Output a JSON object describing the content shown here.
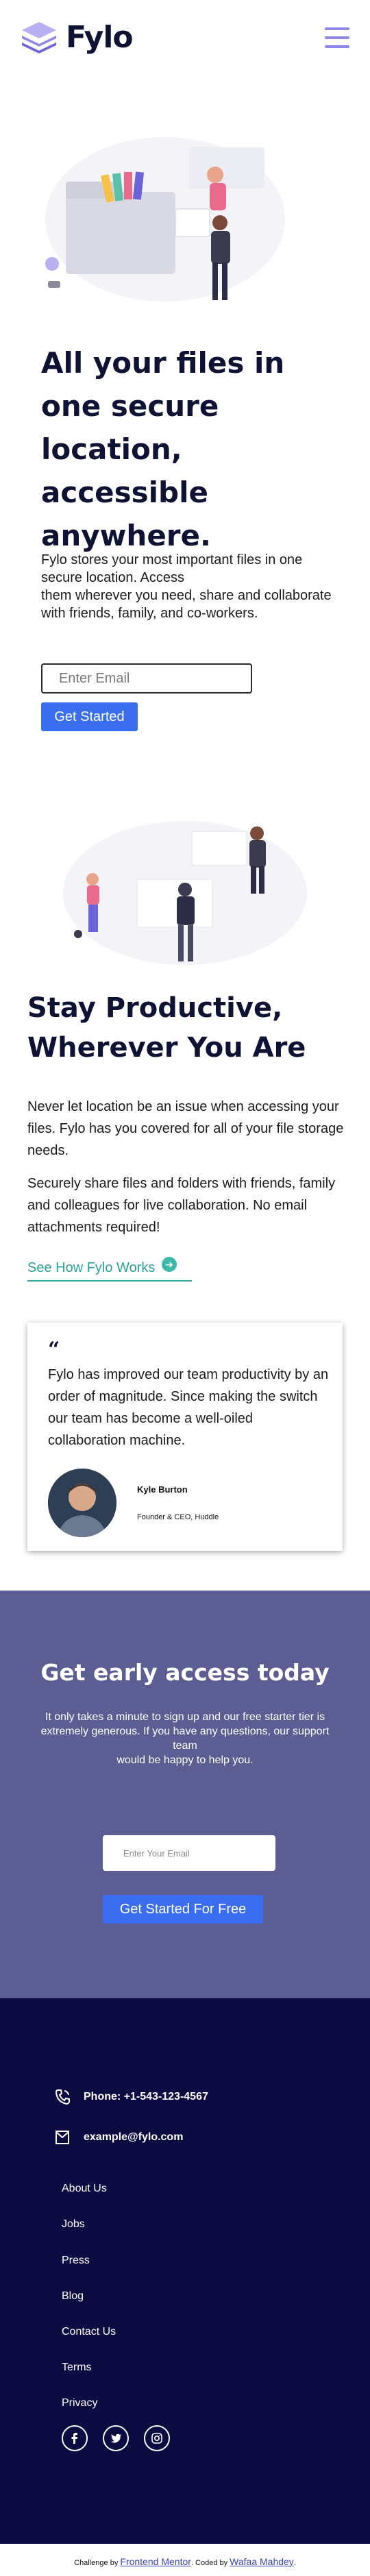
{
  "header": {
    "brand": "Fylo",
    "menu_icon": "hamburger-menu-icon"
  },
  "hero": {
    "title": "All your files in one secure location, accessible anywhere.",
    "text_line1": "Fylo stores your most important files in one secure location. Access",
    "text_line2": "them wherever you need,  share and collaborate with friends, family, and co-workers.",
    "email_placeholder": "Enter Email",
    "cta_label": "Get Started"
  },
  "productive": {
    "title": "Stay Productive, Wherever You Are",
    "paragraph1": "Never let location be an issue when accessing your files. Fylo has you covered for all of your file storage needs.",
    "paragraph2": "Securely share files and folders with friends, family and colleagues for live collaboration. No email attachments required!",
    "link_label": "See How Fylo Works",
    "link_icon": "arrow-right-icon"
  },
  "testimonial": {
    "quote_mark": "“",
    "text": "Fylo has improved our team productivity by an order of magnitude. Since making the switch our team has become a well-oiled collaboration machine.",
    "name": "Kyle Burton",
    "role": "Founder & CEO, Huddle"
  },
  "early_access": {
    "title": "Get early access today",
    "text_line1": "It only takes a minute to sign up and our free starter tier is extremely generous. If you have any questions, our support team",
    "text_line2": "would be happy to help you.",
    "email_placeholder": "Enter Your Email",
    "cta_label": "Get Started For Free"
  },
  "footer": {
    "phone": "Phone: +1-543-123-4567",
    "email": "example@fylo.com",
    "links": [
      "About Us",
      "Jobs",
      "Press",
      "Blog",
      "Contact Us",
      "Terms",
      "Privacy"
    ],
    "socials": [
      "facebook-icon",
      "twitter-icon",
      "instagram-icon"
    ]
  },
  "attribution": {
    "prefix": "Challenge by",
    "challenge_link": "Frontend Mentor",
    "middle": ". Coded by",
    "author_link": "Wafaa Mahdey",
    "suffix": "."
  },
  "colors": {
    "accent_blue": "#3a6df0",
    "teal": "#2aa39a",
    "early_bg": "#5c5d93",
    "footer_bg": "#0c0c43",
    "menu_purple": "#8f88e8"
  }
}
